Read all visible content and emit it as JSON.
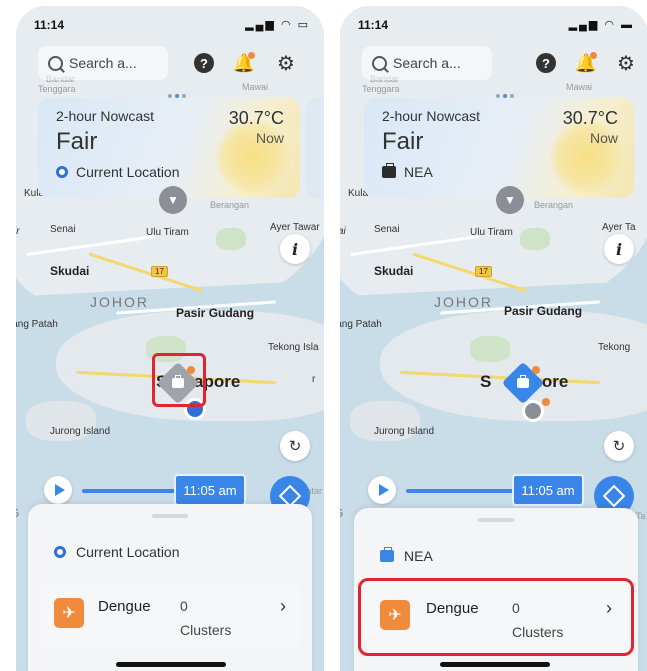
{
  "colors": {
    "accent": "#3a86e8",
    "highlight": "#e0252f",
    "dengue": "#f08a3c"
  },
  "phones": [
    {
      "status": {
        "time": "11:14",
        "icons": "▂▄▆ ◠ ▭"
      },
      "search": {
        "placeholder": "Search a..."
      },
      "weather": {
        "title": "2-hour Nowcast",
        "temperature": "30.7°C",
        "condition": "Fair",
        "when": "Now",
        "source": "Current Location",
        "source_icon": "location-dot-icon"
      },
      "map": {
        "labels": {
          "bandar": "Bandar",
          "tenggara": "Tenggara",
          "mawai": "Mawai",
          "kula": "Kula",
          "berangan": "Berangan",
          "senai": "Senai",
          "ulu_tiram": "Ulu Tiram",
          "ayer_tawar": "Ayer Tawar",
          "skudai": "Skudai",
          "route": "17",
          "johor": "JOHOR",
          "pasir_gudang": "Pasir Gudang",
          "lang_patah": "lang Patah",
          "tekong": "Tekong Isla",
          "singapore_left": "S",
          "singapore_right": "apore",
          "jurong": "Jurong Island",
          "ir": "ir",
          "tatar": "tatar",
          "g": "G",
          "r": "r"
        }
      },
      "timeline": {
        "time": "11:05 am"
      },
      "sheet": {
        "header": "Current Location",
        "item": {
          "name": "Dengue",
          "count": "0",
          "unit": "Clusters"
        }
      }
    },
    {
      "status": {
        "time": "11:14",
        "icons": "▂▄▆ ◠ ▬"
      },
      "search": {
        "placeholder": "Search a..."
      },
      "weather": {
        "title": "2-hour Nowcast",
        "temperature": "30.7°C",
        "condition": "Fair",
        "when": "Now",
        "source": "NEA",
        "source_icon": "briefcase-icon"
      },
      "map": {
        "labels": {
          "bandar": "Bandar",
          "tenggara": "Tenggara",
          "mawai": "Mawai",
          "kula": "Kula",
          "berangan": "Berangan",
          "senai": "Senai",
          "ulu_tiram": "Ulu Tiram",
          "ayer_tawar": "Ayer Ta",
          "skudai": "Skudai",
          "route": "17",
          "johor": "JOHOR",
          "pasir_gudang": "Pasir Gudang",
          "lang_patah": "lang Patah",
          "tekong": "Tekong",
          "singapore_left": "S",
          "singapore_right": "apore",
          "jurong": "Jurong Island",
          "ir": "ai",
          "tatar": "Ta",
          "g": "G",
          "r": ""
        }
      },
      "timeline": {
        "time": "11:05 am"
      },
      "sheet": {
        "header": "NEA",
        "item": {
          "name": "Dengue",
          "count": "0",
          "unit": "Clusters"
        }
      }
    }
  ]
}
